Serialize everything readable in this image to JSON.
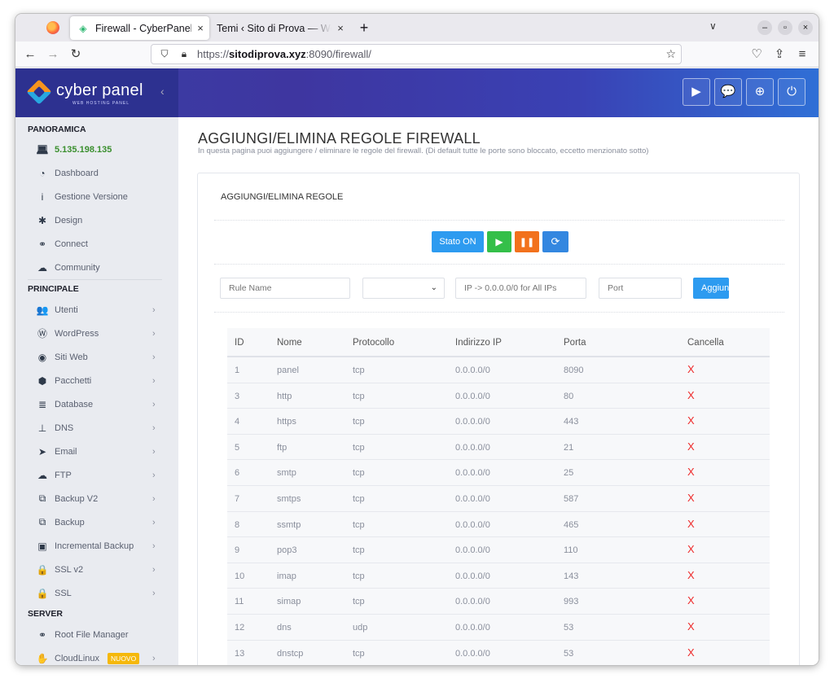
{
  "browser": {
    "tabs": [
      {
        "title": "Firewall - CyberPanel",
        "close": "×"
      },
      {
        "title": "Temi ‹ Sito di Prova — WordPress",
        "close": "×"
      }
    ],
    "new_tab": "+",
    "url_scheme": "https://",
    "url_host": "sitodiprova.xyz",
    "url_rest": ":8090/firewall/"
  },
  "brand": {
    "name": "cyber panel",
    "tagline": "WEB HOSTING PANEL",
    "toggle": "‹"
  },
  "header_buttons": [
    {
      "name": "youtube-icon",
      "glyph": "▶"
    },
    {
      "name": "chat-icon",
      "glyph": "💬"
    },
    {
      "name": "lifebuoy-icon",
      "glyph": "⊕"
    },
    {
      "name": "power-icon",
      "glyph": "⏻"
    }
  ],
  "sidebar": {
    "section_overview": "PANORAMICA",
    "ip_address": "5.135.198.135",
    "overview_items": [
      {
        "label": "Dashboard",
        "icon": "dashboard-icon",
        "glyph": "◔"
      },
      {
        "label": "Gestione Versione",
        "icon": "info-icon",
        "glyph": "i"
      },
      {
        "label": "Design",
        "icon": "cog-icon",
        "glyph": "✱"
      },
      {
        "label": "Connect",
        "icon": "link-icon",
        "glyph": "⚭"
      },
      {
        "label": "Community",
        "icon": "comments-icon",
        "glyph": "☁"
      }
    ],
    "section_main": "PRINCIPALE",
    "main_items": [
      {
        "label": "Utenti",
        "icon": "users-icon",
        "glyph": "👥"
      },
      {
        "label": "WordPress",
        "icon": "wordpress-icon",
        "glyph": "Ⓦ"
      },
      {
        "label": "Siti Web",
        "icon": "globe-icon",
        "glyph": "◉"
      },
      {
        "label": "Pacchetti",
        "icon": "cubes-icon",
        "glyph": "⬢"
      },
      {
        "label": "Database",
        "icon": "database-icon",
        "glyph": "≣"
      },
      {
        "label": "DNS",
        "icon": "sitemap-icon",
        "glyph": "⊥"
      },
      {
        "label": "Email",
        "icon": "paper-plane-icon",
        "glyph": "➤"
      },
      {
        "label": "FTP",
        "icon": "cloud-upload-icon",
        "glyph": "☁"
      },
      {
        "label": "Backup V2",
        "icon": "copy-icon",
        "glyph": "⧉"
      },
      {
        "label": "Backup",
        "icon": "copy-icon",
        "glyph": "⧉"
      },
      {
        "label": "Incremental Backup",
        "icon": "save-icon",
        "glyph": "▣"
      },
      {
        "label": "SSL v2",
        "icon": "lock-icon",
        "glyph": "🔒"
      },
      {
        "label": "SSL",
        "icon": "lock-icon",
        "glyph": "🔒"
      }
    ],
    "chevron": "›",
    "section_server": "SERVER",
    "server_items": [
      {
        "label": "Root File Manager",
        "icon": "link-icon",
        "glyph": "⚭"
      },
      {
        "label": "CloudLinux",
        "icon": "hand-icon",
        "glyph": "✋",
        "badge": "NUOVO"
      }
    ]
  },
  "main": {
    "title": "AGGIUNGI/ELIMINA REGOLE FIREWALL",
    "description": "In questa pagina puoi aggiungere / eliminare le regole del firewall. (Di default tutte le porte sono bloccato, eccetto menzionato sotto)",
    "card_title": "AGGIUNGI/ELIMINA REGOLE",
    "status_button": "Stato ON",
    "form": {
      "rule_name_placeholder": "Rule Name",
      "protocol_value": "",
      "ip_placeholder": "IP -> 0.0.0.0/0 for All IPs",
      "port_placeholder": "Port",
      "add_button": "Aggiungi"
    },
    "table": {
      "headers": [
        "ID",
        "Nome",
        "Protocollo",
        "Indirizzo IP",
        "Porta",
        "Cancella"
      ],
      "delete_glyph": "X",
      "rows": [
        {
          "id": "1",
          "name": "panel",
          "protocol": "tcp",
          "ip": "0.0.0.0/0",
          "port": "8090"
        },
        {
          "id": "3",
          "name": "http",
          "protocol": "tcp",
          "ip": "0.0.0.0/0",
          "port": "80"
        },
        {
          "id": "4",
          "name": "https",
          "protocol": "tcp",
          "ip": "0.0.0.0/0",
          "port": "443"
        },
        {
          "id": "5",
          "name": "ftp",
          "protocol": "tcp",
          "ip": "0.0.0.0/0",
          "port": "21"
        },
        {
          "id": "6",
          "name": "smtp",
          "protocol": "tcp",
          "ip": "0.0.0.0/0",
          "port": "25"
        },
        {
          "id": "7",
          "name": "smtps",
          "protocol": "tcp",
          "ip": "0.0.0.0/0",
          "port": "587"
        },
        {
          "id": "8",
          "name": "ssmtp",
          "protocol": "tcp",
          "ip": "0.0.0.0/0",
          "port": "465"
        },
        {
          "id": "9",
          "name": "pop3",
          "protocol": "tcp",
          "ip": "0.0.0.0/0",
          "port": "110"
        },
        {
          "id": "10",
          "name": "imap",
          "protocol": "tcp",
          "ip": "0.0.0.0/0",
          "port": "143"
        },
        {
          "id": "11",
          "name": "simap",
          "protocol": "tcp",
          "ip": "0.0.0.0/0",
          "port": "993"
        },
        {
          "id": "12",
          "name": "dns",
          "protocol": "udp",
          "ip": "0.0.0.0/0",
          "port": "53"
        },
        {
          "id": "13",
          "name": "dnstcp",
          "protocol": "tcp",
          "ip": "0.0.0.0/0",
          "port": "53"
        }
      ]
    }
  },
  "colors": {
    "header_gradient_start": "#3a3fa6",
    "header_gradient_end": "#2f6fd6",
    "sidebar_bg": "#e9ebf0",
    "ip_green": "#3a8f2e",
    "btn_blue": "#2d9bf0",
    "btn_green": "#34bf49",
    "btn_orange": "#f2711c",
    "delete_red": "#ee2a2a",
    "badge_yellow": "#f5b80a"
  }
}
